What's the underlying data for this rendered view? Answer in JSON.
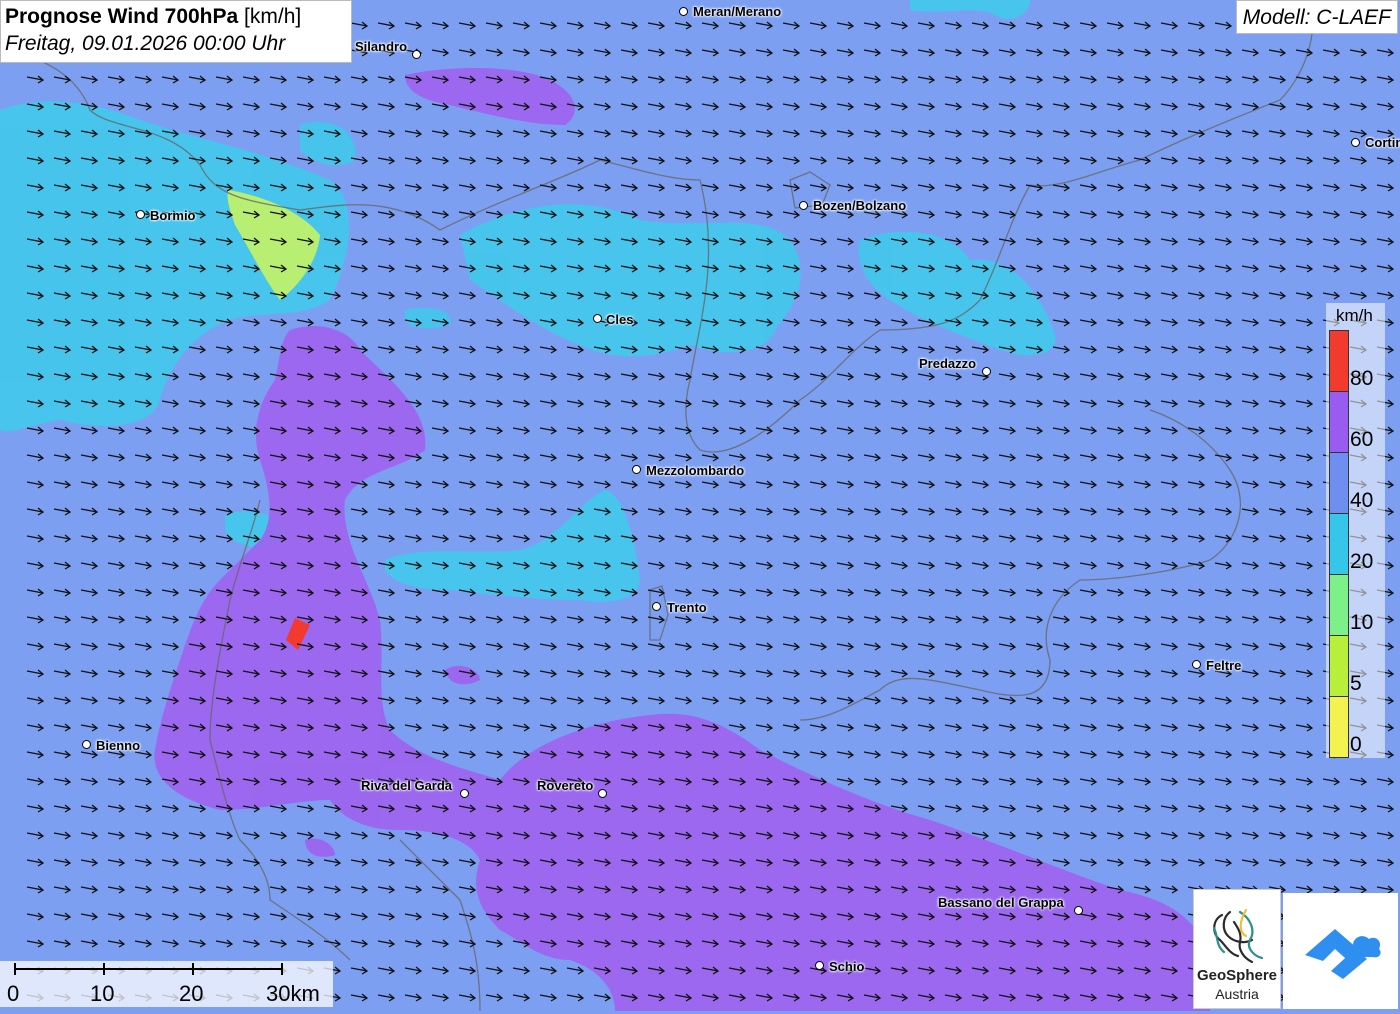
{
  "header": {
    "title_bold": "Prognose Wind 700hPa",
    "title_unit": "[km/h]",
    "datetime": "Freitag, 09.01.2026 00:00 Uhr"
  },
  "model": {
    "label": "Modell: C-LAEF"
  },
  "cities": [
    {
      "name": "Meran/Merano"
    },
    {
      "name": "Silandro"
    },
    {
      "name": "Bormio"
    },
    {
      "name": "Bozen/Bolzano"
    },
    {
      "name": "Cortina"
    },
    {
      "name": "Cles"
    },
    {
      "name": "Predazzo"
    },
    {
      "name": "Mezzolombardo"
    },
    {
      "name": "Trento"
    },
    {
      "name": "Feltre"
    },
    {
      "name": "Bienno"
    },
    {
      "name": "Riva del Garda"
    },
    {
      "name": "Rovereto"
    },
    {
      "name": "Bassano del Grappa"
    },
    {
      "name": "Schio"
    }
  ],
  "legend": {
    "unit": "km/h",
    "bands": [
      {
        "label": "80",
        "color": "#f23a2e"
      },
      {
        "label": "60",
        "color": "#9a5cf0"
      },
      {
        "label": "40",
        "color": "#6f8ff0"
      },
      {
        "label": "20",
        "color": "#35c6ea"
      },
      {
        "label": "10",
        "color": "#7ef08a"
      },
      {
        "label": "5",
        "color": "#b8ef3a"
      },
      {
        "label": "0",
        "color": "#f4f250"
      }
    ]
  },
  "scale": {
    "labels": [
      "0",
      "10",
      "20",
      "30km"
    ]
  },
  "logos": {
    "geosphere_name": "GeoSphere",
    "geosphere_sub": "Austria"
  },
  "colors": {
    "background": "#7d9ff2",
    "cyan_zone": "#3dcbeb",
    "purple_zone": "#9e62ee",
    "yellowgreen_zone": "#bff06a",
    "red_zone": "#f23a2e",
    "arrow": "#111111"
  },
  "wind": {
    "direction": "east"
  }
}
